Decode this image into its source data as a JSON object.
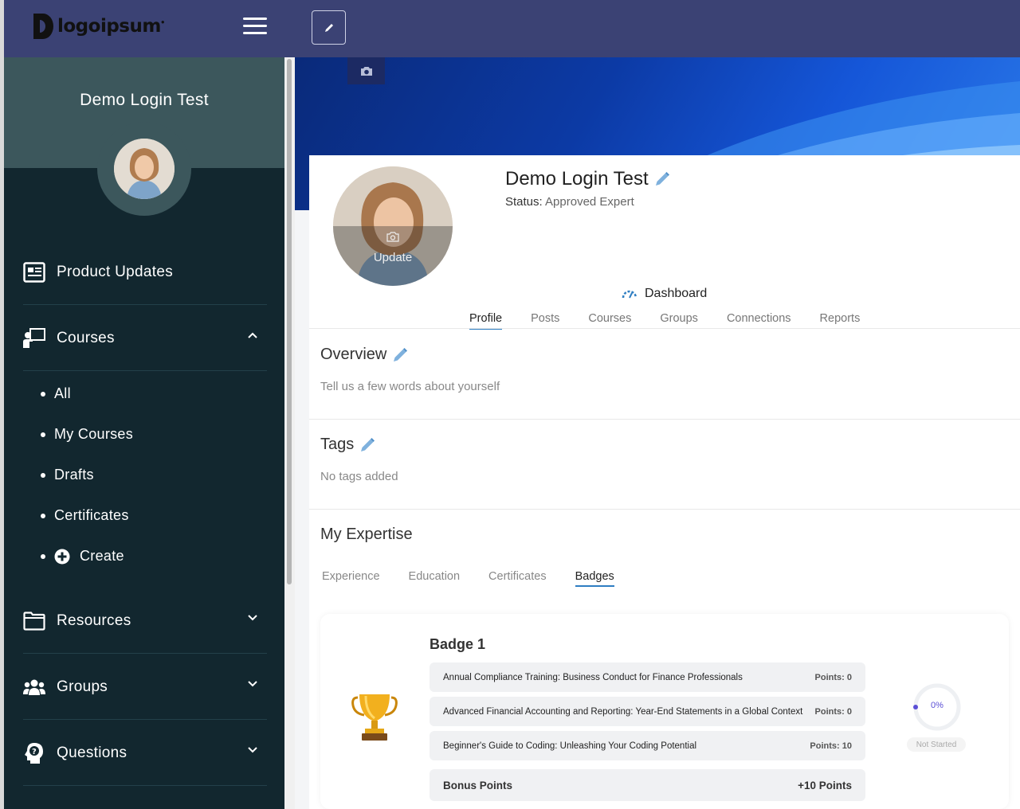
{
  "brand": {
    "logo_text": "logoipsum"
  },
  "sidebar": {
    "user_name": "Demo Login Test",
    "items": [
      {
        "label": "Product Updates",
        "icon": "newspaper-icon"
      },
      {
        "label": "Courses",
        "icon": "teacher-board-icon",
        "expanded": true,
        "children": [
          {
            "label": "All"
          },
          {
            "label": "My Courses"
          },
          {
            "label": "Drafts"
          },
          {
            "label": "Certificates"
          },
          {
            "label": "Create",
            "icon": "plus-circle-icon"
          }
        ]
      },
      {
        "label": "Resources",
        "icon": "folder-icon",
        "expanded": false
      },
      {
        "label": "Groups",
        "icon": "users-icon",
        "expanded": false
      },
      {
        "label": "Questions",
        "icon": "question-head-icon",
        "expanded": false
      }
    ]
  },
  "profile": {
    "name": "Demo Login Test",
    "status_label": "Status:",
    "status_value": "Approved Expert",
    "avatar_update_label": "Update",
    "dashboard_label": "Dashboard",
    "tabs": [
      "Profile",
      "Posts",
      "Courses",
      "Groups",
      "Connections",
      "Reports"
    ],
    "active_tab": "Profile"
  },
  "overview": {
    "title": "Overview",
    "placeholder": "Tell us a few words about yourself"
  },
  "tags": {
    "title": "Tags",
    "empty_text": "No tags added"
  },
  "expertise": {
    "title": "My Expertise",
    "tabs": [
      "Experience",
      "Education",
      "Certificates",
      "Badges"
    ],
    "active_tab": "Badges"
  },
  "badge": {
    "title": "Badge 1",
    "courses": [
      {
        "name": "Annual Compliance Training: Business Conduct for Finance Professionals",
        "points": "Points: 0"
      },
      {
        "name": "Advanced Financial Accounting and Reporting: Year-End Statements in a Global Context",
        "points": "Points: 0"
      },
      {
        "name": "Beginner's Guide to Coding: Unleashing Your Coding Potential",
        "points": "Points: 10"
      }
    ],
    "bonus_label": "Bonus Points",
    "bonus_value": "+10 Points",
    "progress_percent": "0%",
    "progress_status": "Not Started"
  },
  "colors": {
    "topbar": "#3b4274",
    "sidebar": "#12272f",
    "sidebar_header": "#3c575c",
    "accent": "#2e7ec2",
    "progress": "#5b4fd6"
  }
}
